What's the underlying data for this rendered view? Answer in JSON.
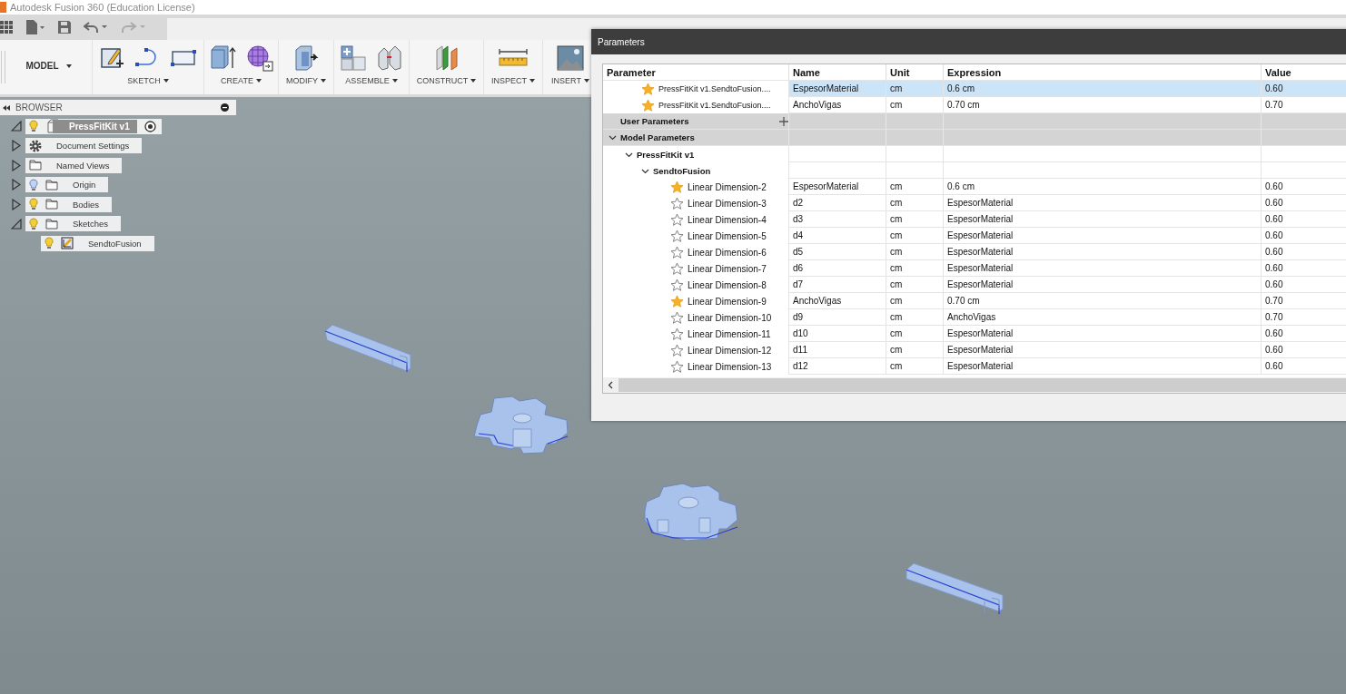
{
  "app": {
    "title": "Autodesk Fusion 360 (Education License)"
  },
  "ribbon": {
    "workspace": "MODEL",
    "groups": [
      {
        "label": "SKETCH"
      },
      {
        "label": "CREATE"
      },
      {
        "label": "MODIFY"
      },
      {
        "label": "ASSEMBLE"
      },
      {
        "label": "CONSTRUCT"
      },
      {
        "label": "INSPECT"
      },
      {
        "label": "INSERT"
      }
    ]
  },
  "browser": {
    "title": "BROWSER",
    "tree": {
      "label": "PressFitKit v1",
      "expanded": true,
      "visible": true,
      "children": [
        {
          "label": "Document Settings",
          "kind": "settings",
          "expanded": false
        },
        {
          "label": "Named Views",
          "kind": "folder",
          "expanded": false
        },
        {
          "label": "Origin",
          "kind": "folder",
          "expanded": false,
          "visible": false
        },
        {
          "label": "Bodies",
          "kind": "folder",
          "expanded": false,
          "visible": true
        },
        {
          "label": "Sketches",
          "kind": "folder",
          "expanded": true,
          "visible": true,
          "children": [
            {
              "label": "SendtoFusion",
              "kind": "sketch",
              "visible": true
            }
          ]
        }
      ]
    }
  },
  "parameters": {
    "title": "Parameters",
    "columns": [
      "Parameter",
      "Name",
      "Unit",
      "Expression",
      "Value"
    ],
    "favorites": [
      {
        "parameter": "PressFitKit v1.SendtoFusion....",
        "name": "EspesorMaterial",
        "unit": "cm",
        "expression": "0.6 cm",
        "value": "0.60",
        "selected": true
      },
      {
        "parameter": "PressFitKit v1.SendtoFusion....",
        "name": "AnchoVigas",
        "unit": "cm",
        "expression": "0.70 cm",
        "value": "0.70",
        "selected": false
      }
    ],
    "sections": [
      {
        "label": "User Parameters",
        "kind": "user"
      },
      {
        "label": "Model Parameters",
        "kind": "model",
        "expanded": true,
        "components": [
          {
            "label": "PressFitKit v1",
            "expanded": true,
            "sketches": [
              {
                "label": "SendtoFusion",
                "expanded": true,
                "rows": [
                  {
                    "parameter": "Linear Dimension-2",
                    "name": "EspesorMaterial",
                    "unit": "cm",
                    "expression": "0.6 cm",
                    "value": "0.60",
                    "favorite": true
                  },
                  {
                    "parameter": "Linear Dimension-3",
                    "name": "d2",
                    "unit": "cm",
                    "expression": "EspesorMaterial",
                    "value": "0.60",
                    "favorite": false
                  },
                  {
                    "parameter": "Linear Dimension-4",
                    "name": "d3",
                    "unit": "cm",
                    "expression": "EspesorMaterial",
                    "value": "0.60",
                    "favorite": false
                  },
                  {
                    "parameter": "Linear Dimension-5",
                    "name": "d4",
                    "unit": "cm",
                    "expression": "EspesorMaterial",
                    "value": "0.60",
                    "favorite": false
                  },
                  {
                    "parameter": "Linear Dimension-6",
                    "name": "d5",
                    "unit": "cm",
                    "expression": "EspesorMaterial",
                    "value": "0.60",
                    "favorite": false
                  },
                  {
                    "parameter": "Linear Dimension-7",
                    "name": "d6",
                    "unit": "cm",
                    "expression": "EspesorMaterial",
                    "value": "0.60",
                    "favorite": false
                  },
                  {
                    "parameter": "Linear Dimension-8",
                    "name": "d7",
                    "unit": "cm",
                    "expression": "EspesorMaterial",
                    "value": "0.60",
                    "favorite": false
                  },
                  {
                    "parameter": "Linear Dimension-9",
                    "name": "AnchoVigas",
                    "unit": "cm",
                    "expression": "0.70 cm",
                    "value": "0.70",
                    "favorite": true
                  },
                  {
                    "parameter": "Linear Dimension-10",
                    "name": "d9",
                    "unit": "cm",
                    "expression": "AnchoVigas",
                    "value": "0.70",
                    "favorite": false
                  },
                  {
                    "parameter": "Linear Dimension-11",
                    "name": "d10",
                    "unit": "cm",
                    "expression": "EspesorMaterial",
                    "value": "0.60",
                    "favorite": false
                  },
                  {
                    "parameter": "Linear Dimension-12",
                    "name": "d11",
                    "unit": "cm",
                    "expression": "EspesorMaterial",
                    "value": "0.60",
                    "favorite": false
                  },
                  {
                    "parameter": "Linear Dimension-13",
                    "name": "d12",
                    "unit": "cm",
                    "expression": "EspesorMaterial",
                    "value": "0.60",
                    "favorite": false
                  }
                ]
              }
            ]
          }
        ]
      }
    ]
  }
}
